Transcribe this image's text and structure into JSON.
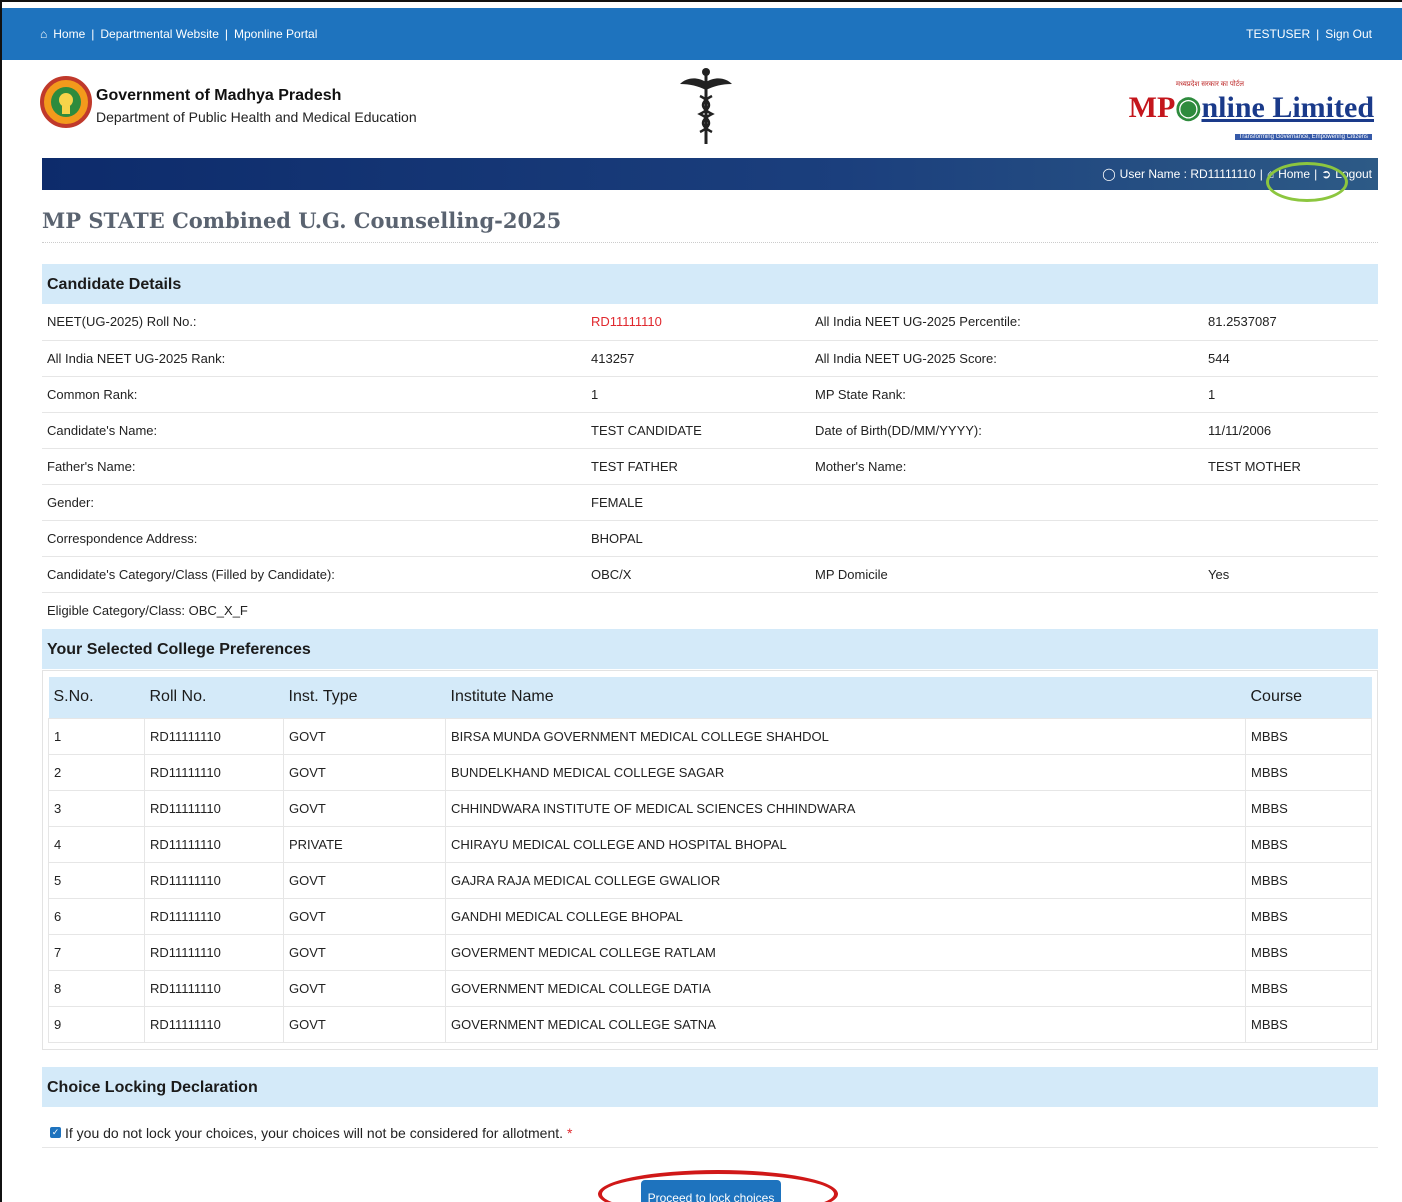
{
  "topbar": {
    "home": "Home",
    "departmental": "Departmental Website",
    "mponline": "Mponline Portal",
    "user": "TESTUSER",
    "signout": "Sign Out"
  },
  "header": {
    "gov_title": "Government of Madhya Pradesh",
    "gov_sub": "Department of Public Health and Medical Education",
    "mp_tag": "मध्यप्रदेश सरकार का पोर्टल",
    "mp_logo_red": "MP",
    "mp_logo_blue": "nline Limited",
    "mp_tagline": "Transforming Governance, Empowering Citizens"
  },
  "nav": {
    "username_label": "User Name : RD11111110",
    "home": "Home",
    "logout": "Logout"
  },
  "page_title": "MP STATE Combined U.G. Counselling-2025",
  "candidate": {
    "section_title": "Candidate Details",
    "rows": [
      {
        "l1": "NEET(UG-2025) Roll No.:",
        "v1": "RD11111110",
        "l2": "All India NEET UG-2025 Percentile:",
        "v2": "81.2537087"
      },
      {
        "l1": "All India NEET UG-2025 Rank:",
        "v1": "413257",
        "l2": "All India NEET UG-2025 Score:",
        "v2": "544"
      },
      {
        "l1": "Common Rank:",
        "v1": "1",
        "l2": "MP State Rank:",
        "v2": "1"
      },
      {
        "l1": "Candidate's Name:",
        "v1": "TEST CANDIDATE",
        "l2": "Date of Birth(DD/MM/YYYY):",
        "v2": "11/11/2006"
      },
      {
        "l1": "Father's Name:",
        "v1": "TEST FATHER",
        "l2": "Mother's Name:",
        "v2": "TEST MOTHER"
      },
      {
        "l1": "Gender:",
        "v1": "FEMALE",
        "l2": "",
        "v2": ""
      },
      {
        "l1": "Correspondence Address:",
        "v1": "BHOPAL",
        "l2": "",
        "v2": ""
      },
      {
        "l1": "Candidate's Category/Class (Filled by Candidate):",
        "v1": "OBC/X",
        "l2": "MP Domicile",
        "v2": "Yes"
      }
    ],
    "eligible": "Eligible Category/Class: OBC_X_F"
  },
  "preferences": {
    "section_title": "Your Selected College Preferences",
    "headers": [
      "S.No.",
      "Roll No.",
      "Inst. Type",
      "Institute Name",
      "Course"
    ],
    "rows": [
      [
        "1",
        "RD11111110",
        "GOVT",
        "BIRSA MUNDA GOVERNMENT MEDICAL COLLEGE SHAHDOL",
        "MBBS"
      ],
      [
        "2",
        "RD11111110",
        "GOVT",
        "BUNDELKHAND MEDICAL COLLEGE SAGAR",
        "MBBS"
      ],
      [
        "3",
        "RD11111110",
        "GOVT",
        "CHHINDWARA INSTITUTE OF MEDICAL SCIENCES CHHINDWARA",
        "MBBS"
      ],
      [
        "4",
        "RD11111110",
        "PRIVATE",
        "CHIRAYU MEDICAL COLLEGE AND HOSPITAL BHOPAL",
        "MBBS"
      ],
      [
        "5",
        "RD11111110",
        "GOVT",
        "GAJRA RAJA MEDICAL COLLEGE GWALIOR",
        "MBBS"
      ],
      [
        "6",
        "RD11111110",
        "GOVT",
        "GANDHI MEDICAL COLLEGE BHOPAL",
        "MBBS"
      ],
      [
        "7",
        "RD11111110",
        "GOVT",
        "GOVERMENT MEDICAL COLLEGE RATLAM",
        "MBBS"
      ],
      [
        "8",
        "RD11111110",
        "GOVT",
        "GOVERNMENT MEDICAL COLLEGE DATIA",
        "MBBS"
      ],
      [
        "9",
        "RD11111110",
        "GOVT",
        "GOVERNMENT MEDICAL COLLEGE SATNA",
        "MBBS"
      ]
    ]
  },
  "declaration": {
    "section_title": "Choice Locking Declaration",
    "text": "If you do not lock your choices, your choices will not be considered for allotment.",
    "required_mark": "*",
    "checked": true
  },
  "proceed_button": "Proceed to lock choices",
  "colors": {
    "topbar": "#1e73be",
    "section_bg": "#d4eaf9",
    "highlight_red": "#d01818",
    "highlight_green": "#8cc63f"
  }
}
